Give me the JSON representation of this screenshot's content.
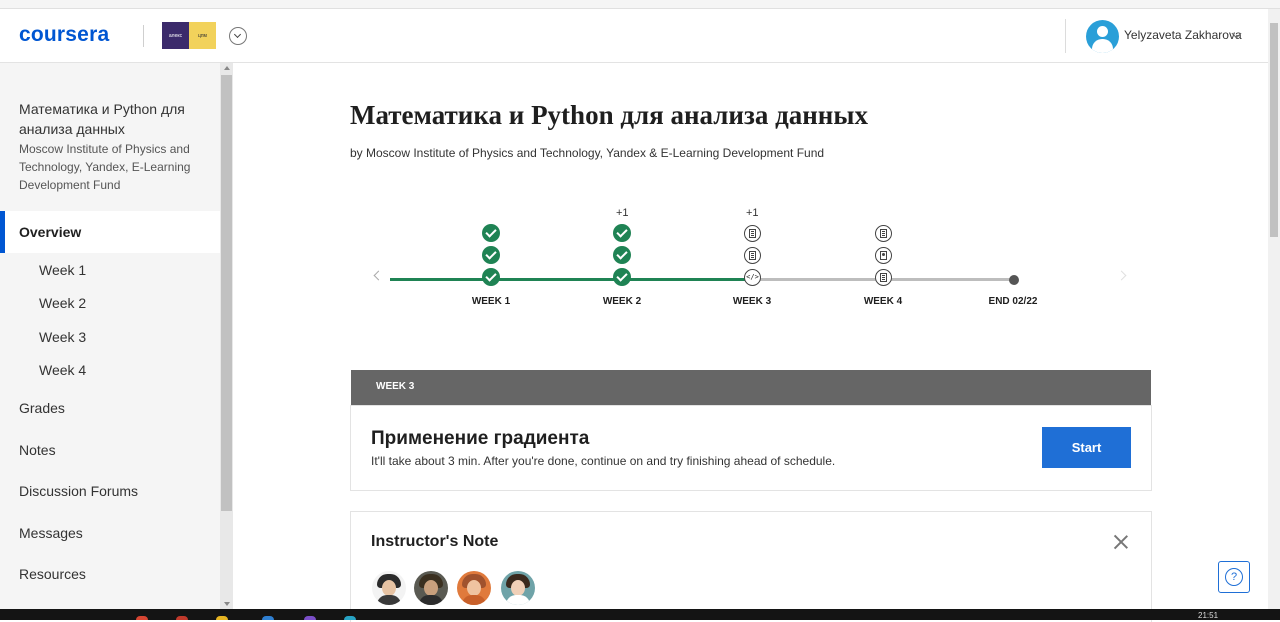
{
  "header": {
    "logo": "coursera",
    "partner_logo_left": "алекс",
    "partner_logo_right": "цпм",
    "user_name": "Yelyzaveta Zakharova"
  },
  "sidebar": {
    "course_title": "Математика и Python для анализа данных",
    "course_partner": "Moscow Institute of Physics and Technology, Yandex, E-Learning Development Fund",
    "overview": "Overview",
    "weeks": [
      "Week 1",
      "Week 2",
      "Week 3",
      "Week 4"
    ],
    "items": [
      "Grades",
      "Notes",
      "Discussion Forums",
      "Messages",
      "Resources"
    ]
  },
  "main": {
    "title": "Математика и Python для анализа данных",
    "byline": "by Moscow Institute of Physics and Technology, Yandex & E-Learning Development Fund"
  },
  "timeline": {
    "labels": [
      "WEEK 1",
      "WEEK 2",
      "WEEK 3",
      "WEEK 4",
      "END 02/22"
    ],
    "extra": [
      "+1",
      "+1"
    ]
  },
  "week_card": {
    "header": "WEEK 3",
    "title": "Применение градиента",
    "subtitle": "It'll take about 3 min. After you're done, continue on and try finishing ahead of schedule.",
    "button": "Start"
  },
  "note": {
    "title": "Instructor's Note"
  },
  "taskbar": {
    "clock": "21:51"
  },
  "colors": {
    "brand": "#0056d2",
    "complete": "#1f8354",
    "button": "#1f6fd6",
    "week_header": "#666666"
  }
}
